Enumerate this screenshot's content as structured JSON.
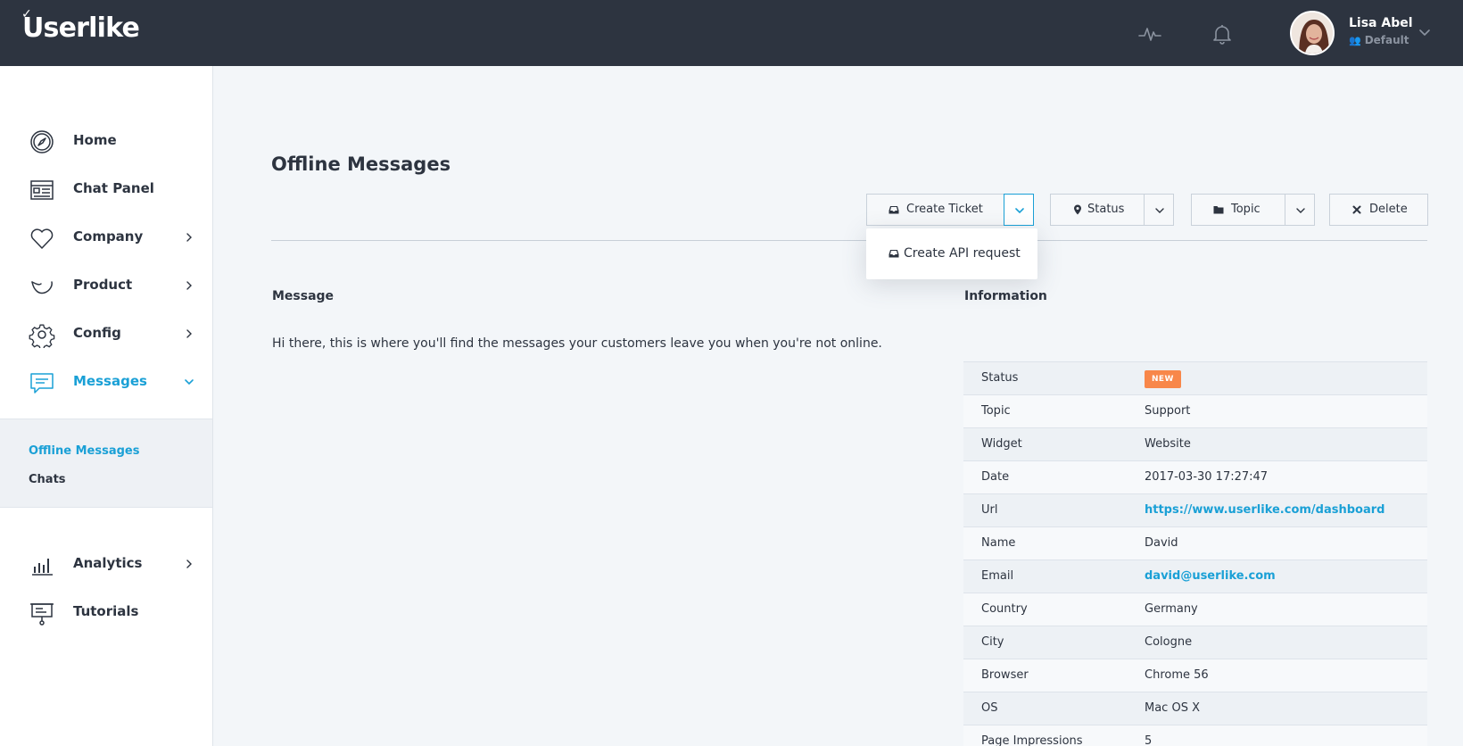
{
  "header": {
    "logo": "Userlike",
    "user": {
      "name": "Lisa Abel",
      "role": "Default"
    },
    "icons": [
      "activity-icon",
      "bell-icon",
      "chevron-down-icon"
    ]
  },
  "sidebar": {
    "items": [
      {
        "label": "Home",
        "icon": "compass-icon"
      },
      {
        "label": "Chat Panel",
        "icon": "chat-panel-icon"
      },
      {
        "label": "Company",
        "icon": "heart-icon"
      },
      {
        "label": "Product",
        "icon": "product-icon"
      },
      {
        "label": "Config",
        "icon": "gear-icon"
      },
      {
        "label": "Messages",
        "icon": "message-icon"
      },
      {
        "label": "Analytics",
        "icon": "bar-chart-icon"
      },
      {
        "label": "Tutorials",
        "icon": "presentation-icon"
      }
    ],
    "subitems": [
      "Offline Messages",
      "Chats"
    ]
  },
  "main": {
    "title": "Offline Messages",
    "toolbar": {
      "create_ticket": "Create Ticket",
      "status": "Status",
      "topic": "Topic",
      "delete": "Delete"
    },
    "dropdown": {
      "create_api": "Create API request"
    },
    "message_heading": "Message",
    "information_heading": "Information",
    "message_text": "Hi there, this is where you'll find the messages your customers leave you when you're not online.",
    "info": [
      {
        "key": "Status",
        "value": "NEW"
      },
      {
        "key": "Topic",
        "value": "Support"
      },
      {
        "key": "Widget",
        "value": "Website"
      },
      {
        "key": "Date",
        "value": "2017-03-30 17:27:47"
      },
      {
        "key": "Url",
        "value": "https://www.userlike.com/dashboard"
      },
      {
        "key": "Name",
        "value": "David"
      },
      {
        "key": "Email",
        "value": "david@userlike.com"
      },
      {
        "key": "Country",
        "value": "Germany"
      },
      {
        "key": "City",
        "value": "Cologne"
      },
      {
        "key": "Browser",
        "value": "Chrome 56"
      },
      {
        "key": "OS",
        "value": "Mac OS X"
      },
      {
        "key": "Page Impressions",
        "value": "5"
      }
    ]
  },
  "colors": {
    "topbar": "#2d3440",
    "accent": "#1aa0d6",
    "badge": "#f8874a"
  }
}
